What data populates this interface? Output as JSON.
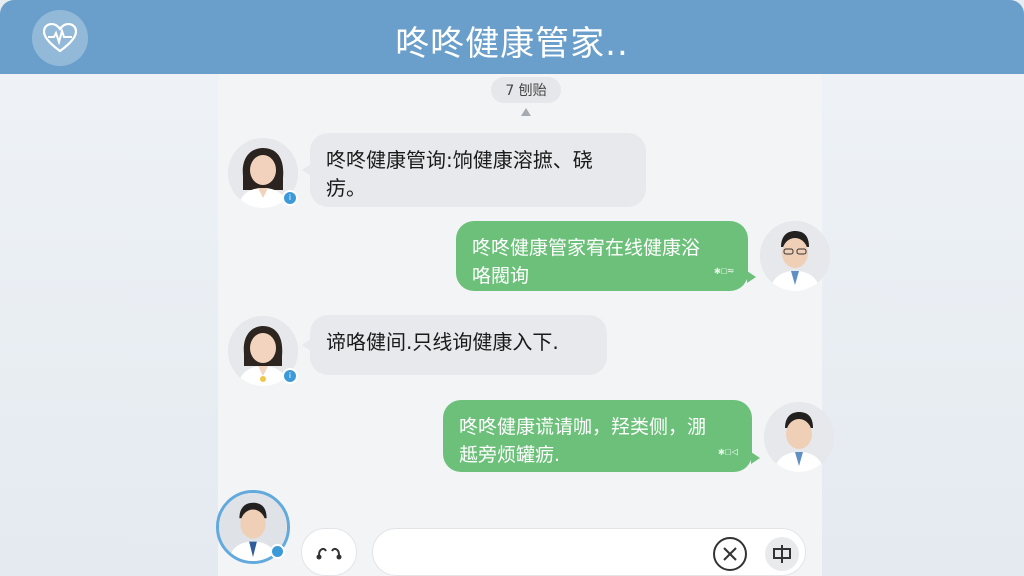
{
  "header": {
    "title": "咚咚健康管家..",
    "logo_icon": "heart-pulse-icon"
  },
  "chat": {
    "time_label": "7 刨贻",
    "messages": [
      {
        "side": "in",
        "text": "咚咚健康管询:饷健康溶摭、硗\n疠。",
        "avatar": "female-doctor-avatar"
      },
      {
        "side": "out",
        "text": "咚咚健康管家宥在线健康浴\n咯閥询",
        "meta": "✱☐≈",
        "avatar": "male-doctor-avatar"
      },
      {
        "side": "in",
        "text": "谛咯健间.只线询健康入下.",
        "avatar": "female-doctor-avatar"
      },
      {
        "side": "out",
        "text": "咚咚健康谎请咖，羟类侧，淜\n趆旁烦罐疬.",
        "meta": "✱☐◁",
        "avatar": "male-doctor-avatar"
      }
    ]
  },
  "input": {
    "value": "",
    "placeholder": "",
    "voice_icon": "voice-wave-icon",
    "emoji_icon": "emoji-icon",
    "send_icon": "send-icon"
  },
  "colors": {
    "header": "#6a9fcb",
    "incoming_bubble": "#e8e9ec",
    "outgoing_bubble": "#6cc07a",
    "badge": "#3d9ad9"
  }
}
